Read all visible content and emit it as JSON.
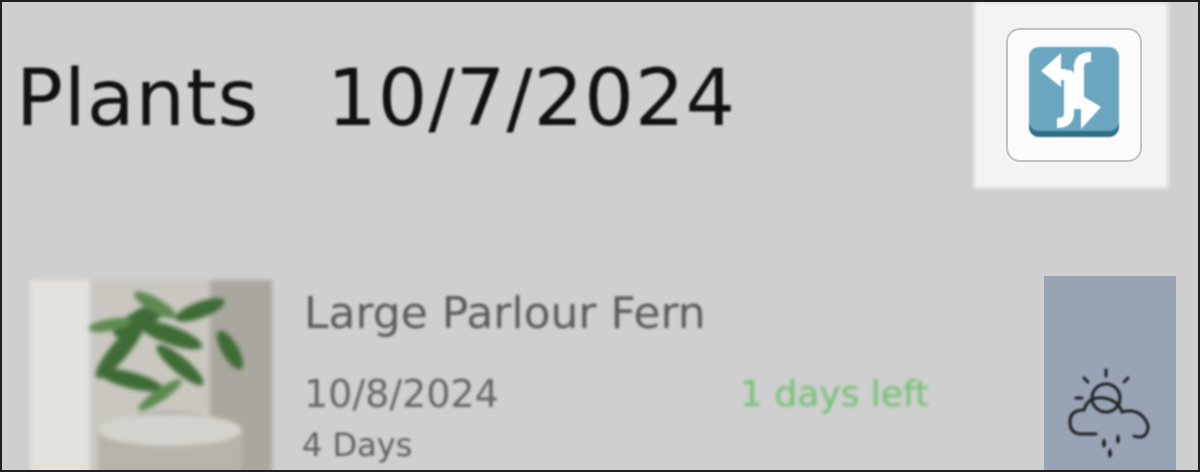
{
  "header": {
    "title": "Plants",
    "date": "10/7/2024",
    "refresh_icon": "refresh-arrows-icon",
    "refresh_colors": {
      "tile": "#5f9eb7",
      "arrows": "#ffffff"
    }
  },
  "plants": [
    {
      "name": "Large Parlour Fern",
      "next_watering_date": "10/8/2024",
      "days_left": "1 days left",
      "interval": "4 Days",
      "water_icon": "weather-rain-icon"
    }
  ],
  "colors": {
    "background": "#cfcfcf",
    "days_left": "#6fc06f",
    "water_button": "#98a4b6"
  }
}
